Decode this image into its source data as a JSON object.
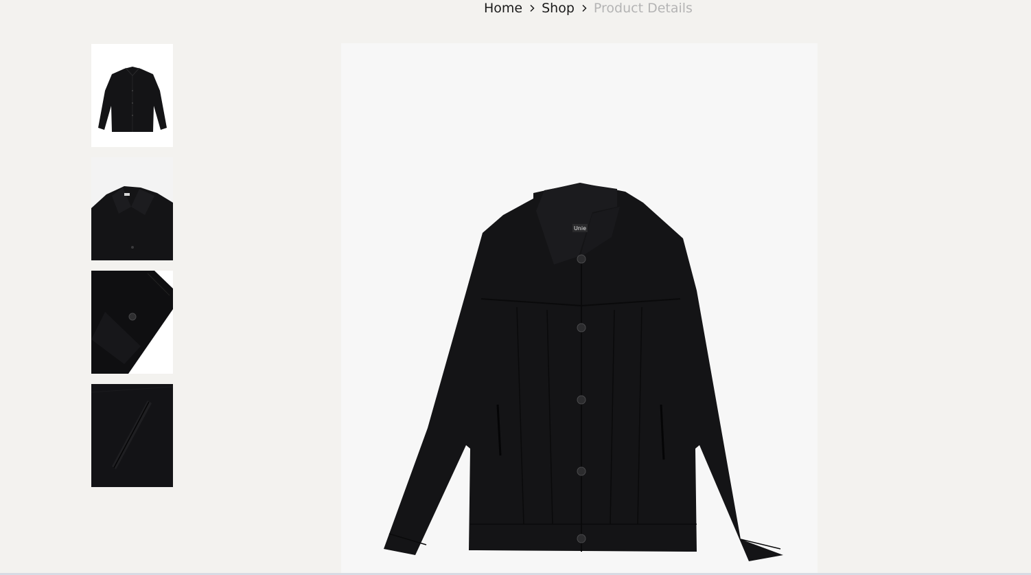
{
  "breadcrumb": {
    "items": [
      {
        "label": "Home"
      },
      {
        "label": "Shop"
      }
    ],
    "current": "Product Details",
    "separator_icon": "chevron-right-icon"
  },
  "gallery": {
    "thumbnails": [
      {
        "view": "front-full"
      },
      {
        "view": "collar-detail"
      },
      {
        "view": "cuff-button-detail"
      },
      {
        "view": "pocket-detail"
      }
    ],
    "main_view": "front-full"
  },
  "jacket": {
    "color": "#141416",
    "background": "#f7f7f7",
    "label_text": "Unie"
  },
  "colors": {
    "page_bg": "#f3f2ef",
    "text": "#1a1a1a",
    "muted": "#b4b4b4"
  }
}
